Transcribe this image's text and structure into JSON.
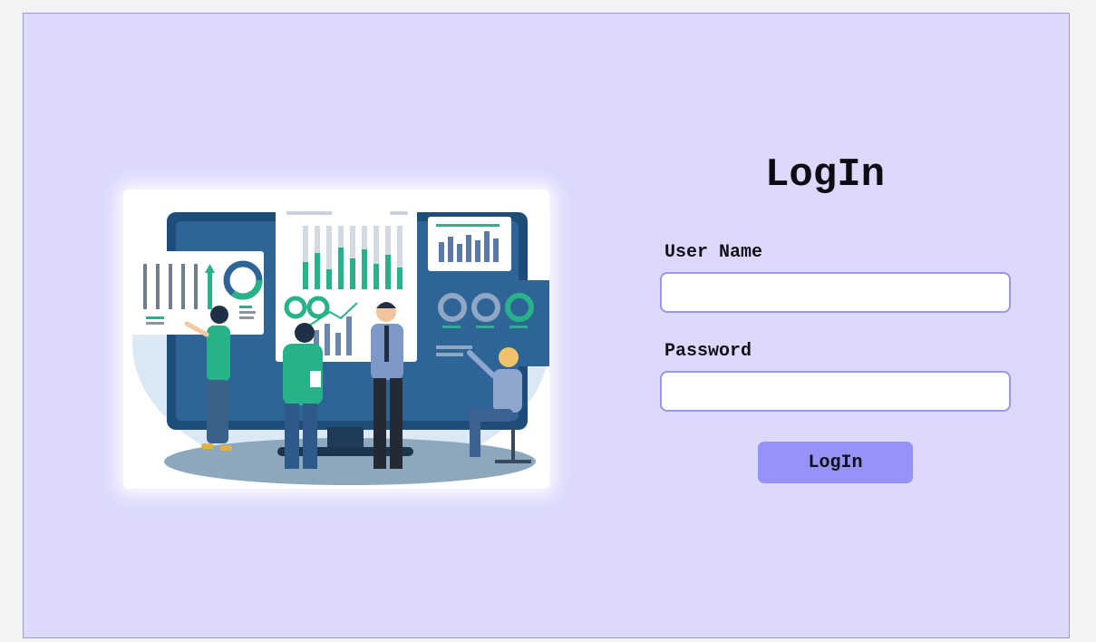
{
  "login": {
    "title": "LogIn",
    "username_label": "User Name",
    "username_value": "",
    "password_label": "Password",
    "password_value": "",
    "submit_label": "LogIn"
  },
  "colors": {
    "frame_background": "#dcd9fc",
    "frame_border": "#9c97ea",
    "input_border": "#9b95ec",
    "button_background": "#9592f8"
  },
  "illustration": {
    "subject": "analytics-team-illustration"
  }
}
